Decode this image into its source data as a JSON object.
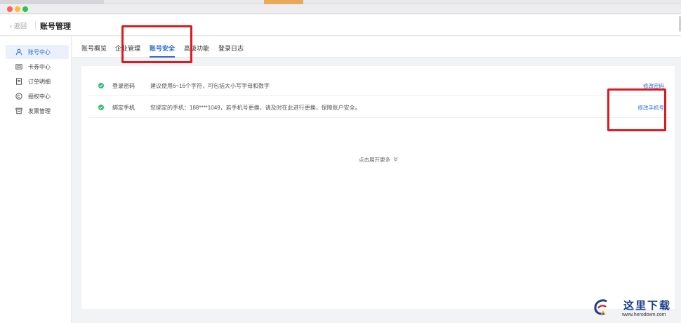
{
  "app": {
    "back_label": "返回",
    "title": "账号管理"
  },
  "sidebar": {
    "items": [
      {
        "label": "账号中心",
        "icon": "user-icon",
        "active": true
      },
      {
        "label": "卡券中心",
        "icon": "ticket-icon",
        "active": false
      },
      {
        "label": "订单明细",
        "icon": "document-icon",
        "active": false
      },
      {
        "label": "授权中心",
        "icon": "copyright-icon",
        "active": false
      },
      {
        "label": "发票管理",
        "icon": "invoice-icon",
        "active": false
      }
    ]
  },
  "tabs": [
    {
      "label": "账号概览",
      "active": false
    },
    {
      "label": "企业管理",
      "active": false
    },
    {
      "label": "账号安全",
      "active": true
    },
    {
      "label": "高级功能",
      "active": false
    },
    {
      "label": "登录日志",
      "active": false
    }
  ],
  "security": {
    "rows": [
      {
        "label": "登录密码",
        "desc": "建议使用6~16个字符，可包括大小写字母和数字",
        "action": "修改密码"
      },
      {
        "label": "绑定手机",
        "desc": "您绑定的手机：188****1049，若手机号更换，请及时在此进行更换，保障账户安全。",
        "action": "修改手机号"
      }
    ],
    "expand_label": "点击展开更多"
  },
  "watermark": {
    "title": "这里下载",
    "url": "www.herodown.com"
  },
  "colors": {
    "accent": "#2d6ad6",
    "success": "#2fbf71",
    "annotation": "#e0191f"
  }
}
